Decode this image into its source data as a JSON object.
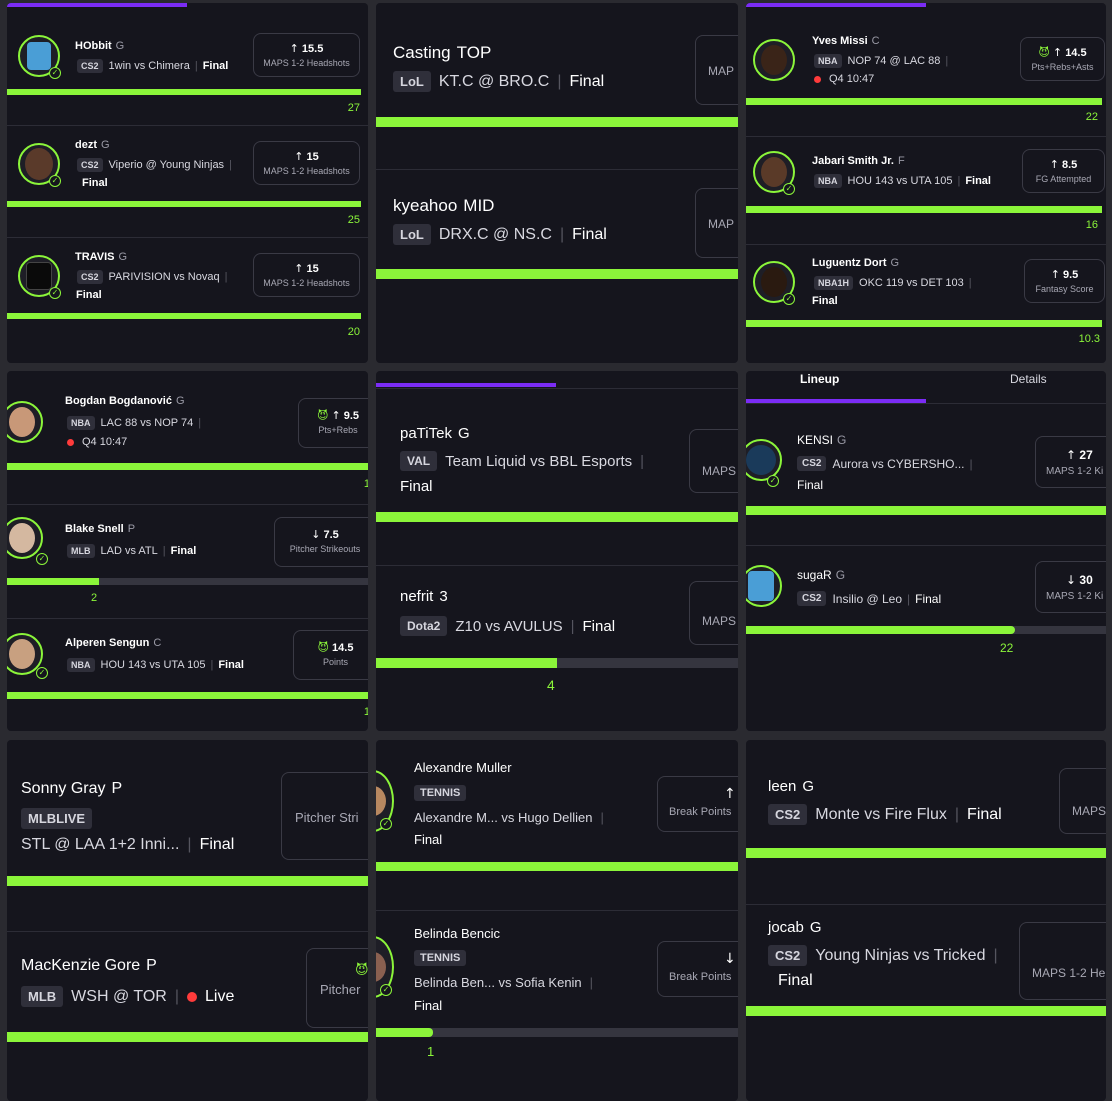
{
  "c1": {
    "rows": [
      {
        "name": "HObbit",
        "pos": "G",
        "league": "CS2",
        "match": "1win vs Chimera",
        "status": "Final",
        "dir": "↑",
        "line": "15.5",
        "stat": "MAPS 1-2 Headshots",
        "result": "27",
        "fill": 1.0
      },
      {
        "name": "dezt",
        "pos": "G",
        "league": "CS2",
        "match": "Viperio @ Young Ninjas",
        "status": "Final",
        "dir": "↑",
        "line": "15",
        "stat": "MAPS 1-2 Headshots",
        "result": "25",
        "fill": 1.0
      },
      {
        "name": "TRAVIS",
        "pos": "G",
        "league": "CS2",
        "match": "PARIVISION vs Novaq",
        "status": "Final",
        "dir": "↑",
        "line": "15",
        "stat": "MAPS 1-2 Headshots",
        "result": "20",
        "fill": 1.0
      }
    ]
  },
  "c2": {
    "rows": [
      {
        "name": "Casting",
        "pos": "TOP",
        "league": "LoL",
        "match": "KT.C @ BRO.C",
        "status": "Final",
        "stat": "MAP"
      },
      {
        "name": "kyeahoo",
        "pos": "MID",
        "league": "LoL",
        "match": "DRX.C @ NS.C",
        "status": "Final",
        "stat": "MAP"
      }
    ]
  },
  "c3": {
    "rows": [
      {
        "name": "Yves Missi",
        "pos": "C",
        "league": "NBA",
        "match": "NOP 74 @ LAC 88",
        "clock": "Q4 10:47",
        "dir": "↑",
        "line": "14.5",
        "stat": "Pts+Rebs+Asts",
        "result": "22",
        "fill": 1.0,
        "demon": "true"
      },
      {
        "name": "Jabari Smith Jr.",
        "pos": "F",
        "league": "NBA",
        "match": "HOU 143 vs UTA 105",
        "status": "Final",
        "dir": "↑",
        "line": "8.5",
        "stat": "FG Attempted",
        "result": "16",
        "fill": 1.0
      },
      {
        "name": "Luguentz Dort",
        "pos": "G",
        "league": "NBA1H",
        "match": "OKC 119 vs DET 103",
        "status": "Final",
        "dir": "↑",
        "line": "9.5",
        "stat": "Fantasy Score",
        "result": "10.3",
        "fill": 1.0
      }
    ]
  },
  "c4": {
    "rows": [
      {
        "name": "Bogdan Bogdanović",
        "pos": "G",
        "league": "NBA",
        "match": "LAC 88 vs NOP 74",
        "clock": "Q4 10:47",
        "dir": "↑",
        "line": "9.5",
        "stat": "Pts+Rebs",
        "result": "1",
        "fill": 1.0,
        "demon": "true"
      },
      {
        "name": "Blake Snell",
        "pos": "P",
        "league": "MLB",
        "match": "LAD vs ATL",
        "status": "Final",
        "dir": "↓",
        "line": "7.5",
        "stat": "Pitcher Strikeouts",
        "result": "2",
        "fill": 0.25
      },
      {
        "name": "Alperen Sengun",
        "pos": "C",
        "league": "NBA",
        "match": "HOU 143 vs UTA 105",
        "status": "Final",
        "dir": "",
        "line": "14.5",
        "stat": "Points",
        "result": "1",
        "fill": 1.0,
        "demon": "true"
      }
    ]
  },
  "c5": {
    "rows": [
      {
        "name": "paTiTek",
        "pos": "G",
        "league": "VAL",
        "match": "Team Liquid vs BBL Esports",
        "status": "Final",
        "stat": "MAPS",
        "fill": 1.0,
        "result": ""
      },
      {
        "name": "nefrit",
        "pos": "3",
        "league": "Dota2",
        "match": "Z10 vs AVULUS",
        "status": "Final",
        "stat": "MAPS",
        "result": "4",
        "fill": 0.5
      }
    ]
  },
  "c6": {
    "tabs": {
      "lineup": "Lineup",
      "details": "Details"
    },
    "rows": [
      {
        "name": "KENSI",
        "pos": "G",
        "league": "CS2",
        "match": "Aurora vs CYBERSHO...",
        "status": "Final",
        "dir": "↑",
        "line": "27",
        "stat": "MAPS 1-2 Ki",
        "fill": 1.0
      },
      {
        "name": "sugaR",
        "pos": "G",
        "league": "CS2",
        "match": "Insilio @ Leo",
        "status": "Final",
        "dir": "↓",
        "line": "30",
        "stat": "MAPS 1-2 Ki",
        "result": "22",
        "fill": 0.73
      }
    ]
  },
  "c7": {
    "rows": [
      {
        "name": "Sonny Gray",
        "pos": "P",
        "league": "MLBLIVE",
        "match": "STL @ LAA 1+2 Inni...",
        "status": "Final",
        "stat": "Pitcher Stri"
      },
      {
        "name": "MacKenzie Gore",
        "pos": "P",
        "league": "MLB",
        "match": "WSH @ TOR",
        "status": "Live",
        "stat": "Pitcher",
        "demon": "true"
      }
    ]
  },
  "c8": {
    "rows": [
      {
        "name": "Alexandre Muller",
        "league": "TENNIS",
        "match": "Alexandre M... vs Hugo Dellien",
        "status": "Final",
        "dir": "↑",
        "stat": "Break Points"
      },
      {
        "name": "Belinda Bencic",
        "league": "TENNIS",
        "match": "Belinda Ben... vs Sofia Kenin",
        "status": "Final",
        "dir": "↓",
        "stat": "Break Points",
        "result": "1",
        "fill": 0.16
      }
    ]
  },
  "c9": {
    "rows": [
      {
        "name": "leen",
        "pos": "G",
        "league": "CS2",
        "match": "Monte vs Fire Flux",
        "status": "Final",
        "stat": "MAPS"
      },
      {
        "name": "jocab",
        "pos": "G",
        "league": "CS2",
        "match": "Young Ninjas vs Tricked",
        "status": "Final",
        "stat": "MAPS 1-2 He"
      }
    ]
  },
  "theme": {
    "accent": "#8bf53a",
    "tab": "#7b2cf5",
    "live": "#ff3b3b",
    "bg": "#15151d"
  }
}
